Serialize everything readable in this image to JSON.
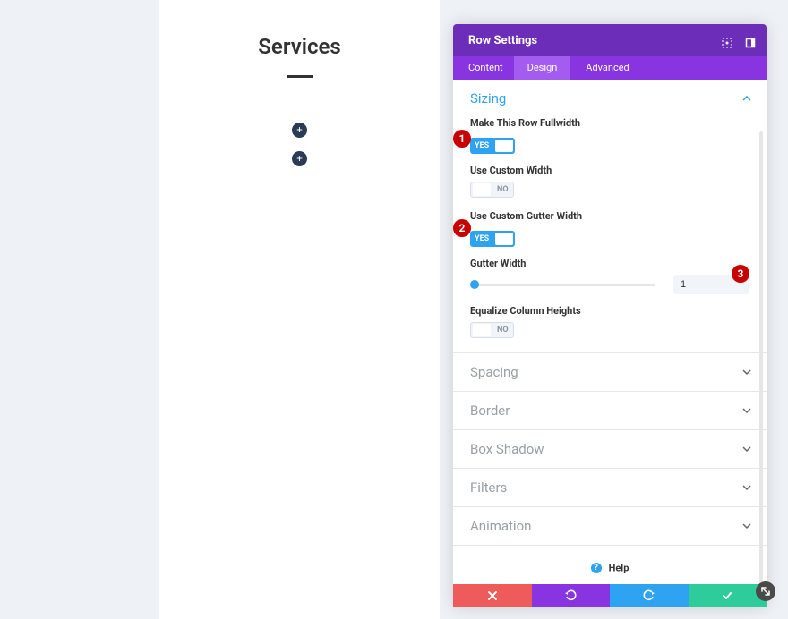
{
  "canvas": {
    "title": "Services"
  },
  "panel": {
    "title": "Row Settings",
    "tabs": {
      "content": "Content",
      "design": "Design",
      "advanced": "Advanced"
    }
  },
  "sections": {
    "sizing": "Sizing",
    "spacing": "Spacing",
    "border": "Border",
    "box_shadow": "Box Shadow",
    "filters": "Filters",
    "animation": "Animation"
  },
  "fields": {
    "fullwidth": {
      "label": "Make This Row Fullwidth",
      "value": "YES"
    },
    "custom_width": {
      "label": "Use Custom Width",
      "value": "NO"
    },
    "custom_gutter": {
      "label": "Use Custom Gutter Width",
      "value": "YES"
    },
    "gutter_width": {
      "label": "Gutter Width",
      "value": "1"
    },
    "equalize": {
      "label": "Equalize Column Heights",
      "value": "NO"
    }
  },
  "help": {
    "label": "Help"
  },
  "markers": {
    "m1": "1",
    "m2": "2",
    "m3": "3"
  }
}
